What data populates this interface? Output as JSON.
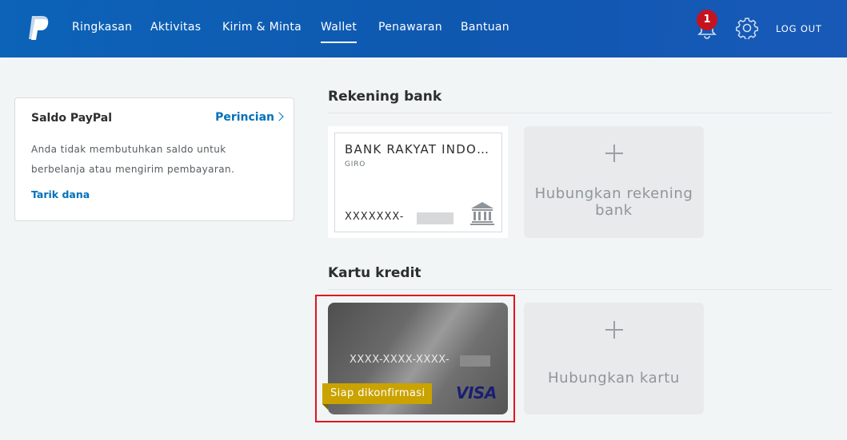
{
  "header": {
    "nav": [
      {
        "label": "Ringkasan"
      },
      {
        "label": "Aktivitas"
      },
      {
        "label": "Kirim & Minta"
      },
      {
        "label": "Wallet"
      },
      {
        "label": "Penawaran"
      },
      {
        "label": "Bantuan"
      }
    ],
    "active_nav": "Wallet",
    "notification_count": "1",
    "logout_label": "LOG OUT",
    "icons": [
      "paypal-logo",
      "bell-icon",
      "gear-icon"
    ],
    "colors": {
      "bar": "#0f5fb5",
      "badge": "#c4141f"
    }
  },
  "balance": {
    "title": "Saldo PayPal",
    "details_link": "Perincian",
    "description": "Anda tidak membutuhkan saldo untuk berbelanja atau mengirim pembayaran.",
    "withdraw_link": "Tarik dana"
  },
  "bank_section": {
    "title": "Rekening bank",
    "bank": {
      "name": "BANK RAKYAT INDONESIA",
      "type": "GIRO",
      "number": "XXXXXXX-"
    },
    "add_label": "Hubungkan rekening bank"
  },
  "card_section": {
    "title": "Kartu kredit",
    "card": {
      "number": "XXXX-XXXX-XXXX-",
      "brand": "VISA",
      "status": "Siap dikonfirmasi"
    },
    "add_label": "Hubungkan kartu",
    "colors": {
      "status_badge": "#caa300",
      "highlight": "#e1141e",
      "visa": "#1a1f71"
    }
  }
}
